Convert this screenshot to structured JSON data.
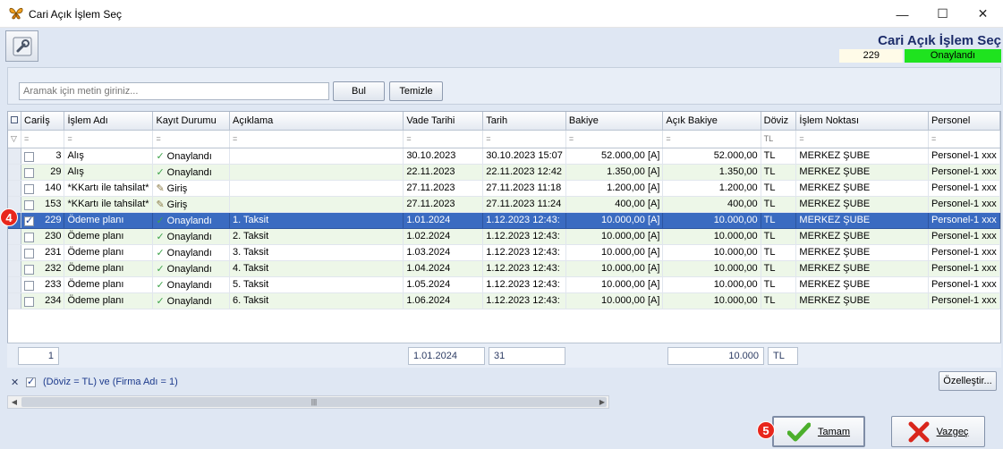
{
  "window": {
    "title": "Cari Açık İşlem Seç",
    "minimize": "—",
    "maximize": "☐",
    "close": "✕"
  },
  "header": {
    "title": "Cari Açık İşlem Seç",
    "record_id": "229",
    "record_status": "Onaylandı",
    "status_color": "#1fe31f"
  },
  "search": {
    "placeholder": "Aramak için metin giriniz...",
    "find_label": "Bul",
    "clear_label": "Temizle"
  },
  "table": {
    "columns": [
      "Cariİş",
      "İşlem Adı",
      "Kayıt Durumu",
      "Açıklama",
      "Vade Tarihi",
      "Tarih",
      "Bakiye",
      "Açık Bakiye",
      "Döviz",
      "İşlem Noktası",
      "Personel"
    ],
    "filter_placeholder": "=",
    "filter_doviz": "TL",
    "rows": [
      {
        "checked": false,
        "id": "3",
        "name": "Alış",
        "status": "Onaylandı",
        "status_icon": "check-icon",
        "desc": "",
        "due": "30.10.2023",
        "date": "30.10.2023 15:07",
        "balance": "52.000,00 [A]",
        "open_balance": "52.000,00",
        "currency": "TL",
        "point": "MERKEZ ŞUBE",
        "staff": "Personel-1 xxx"
      },
      {
        "checked": false,
        "id": "29",
        "name": "Alış",
        "status": "Onaylandı",
        "status_icon": "check-icon",
        "desc": "",
        "due": "22.11.2023",
        "date": "22.11.2023 12:42",
        "balance": "1.350,00 [A]",
        "open_balance": "1.350,00",
        "currency": "TL",
        "point": "MERKEZ ŞUBE",
        "staff": "Personel-1 xxx"
      },
      {
        "checked": false,
        "id": "140",
        "name": "*KKartı ile tahsilat*",
        "status": "Giriş",
        "status_icon": "edit-icon",
        "desc": "",
        "due": "27.11.2023",
        "date": "27.11.2023 11:18",
        "balance": "1.200,00 [A]",
        "open_balance": "1.200,00",
        "currency": "TL",
        "point": "MERKEZ ŞUBE",
        "staff": "Personel-1 xxx"
      },
      {
        "checked": false,
        "id": "153",
        "name": "*KKartı ile tahsilat*",
        "status": "Giriş",
        "status_icon": "edit-icon",
        "desc": "",
        "due": "27.11.2023",
        "date": "27.11.2023 11:24",
        "balance": "400,00 [A]",
        "open_balance": "400,00",
        "currency": "TL",
        "point": "MERKEZ ŞUBE",
        "staff": "Personel-1 xxx"
      },
      {
        "checked": true,
        "selected": true,
        "id": "229",
        "name": "Ödeme planı",
        "status": "Onaylandı",
        "status_icon": "check-icon",
        "desc": "1. Taksit",
        "due": "1.01.2024",
        "date": "1.12.2023 12:43:",
        "balance": "10.000,00 [A]",
        "open_balance": "10.000,00",
        "currency": "TL",
        "point": "MERKEZ ŞUBE",
        "staff": "Personel-1 xxx"
      },
      {
        "checked": false,
        "id": "230",
        "name": "Ödeme planı",
        "status": "Onaylandı",
        "status_icon": "check-icon",
        "desc": "2. Taksit",
        "due": "1.02.2024",
        "date": "1.12.2023 12:43:",
        "balance": "10.000,00 [A]",
        "open_balance": "10.000,00",
        "currency": "TL",
        "point": "MERKEZ ŞUBE",
        "staff": "Personel-1 xxx"
      },
      {
        "checked": false,
        "id": "231",
        "name": "Ödeme planı",
        "status": "Onaylandı",
        "status_icon": "check-icon",
        "desc": "3. Taksit",
        "due": "1.03.2024",
        "date": "1.12.2023 12:43:",
        "balance": "10.000,00 [A]",
        "open_balance": "10.000,00",
        "currency": "TL",
        "point": "MERKEZ ŞUBE",
        "staff": "Personel-1 xxx"
      },
      {
        "checked": false,
        "id": "232",
        "name": "Ödeme planı",
        "status": "Onaylandı",
        "status_icon": "check-icon",
        "desc": "4. Taksit",
        "due": "1.04.2024",
        "date": "1.12.2023 12:43:",
        "balance": "10.000,00 [A]",
        "open_balance": "10.000,00",
        "currency": "TL",
        "point": "MERKEZ ŞUBE",
        "staff": "Personel-1 xxx"
      },
      {
        "checked": false,
        "id": "233",
        "name": "Ödeme planı",
        "status": "Onaylandı",
        "status_icon": "check-icon",
        "desc": "5. Taksit",
        "due": "1.05.2024",
        "date": "1.12.2023 12:43:",
        "balance": "10.000,00 [A]",
        "open_balance": "10.000,00",
        "currency": "TL",
        "point": "MERKEZ ŞUBE",
        "staff": "Personel-1 xxx"
      },
      {
        "checked": false,
        "id": "234",
        "name": "Ödeme planı",
        "status": "Onaylandı",
        "status_icon": "check-icon",
        "desc": "6. Taksit",
        "due": "1.06.2024",
        "date": "1.12.2023 12:43:",
        "balance": "10.000,00 [A]",
        "open_balance": "10.000,00",
        "currency": "TL",
        "point": "MERKEZ ŞUBE",
        "staff": "Personel-1 xxx"
      }
    ],
    "footer": {
      "count": "1",
      "due": "1.01.2024",
      "date": "31",
      "open_balance": "10.000",
      "currency": "TL"
    }
  },
  "filter_bar": {
    "close": "✕",
    "expression": "(Döviz = TL) ve (Firma Adı = 1)",
    "customize_label": "Özelleştir..."
  },
  "scrollbar": {
    "grip": "|||"
  },
  "buttons": {
    "ok_label": "Tamam",
    "cancel_label": "Vazgeç"
  },
  "callouts": {
    "row_marker": "4",
    "ok_marker": "5"
  }
}
